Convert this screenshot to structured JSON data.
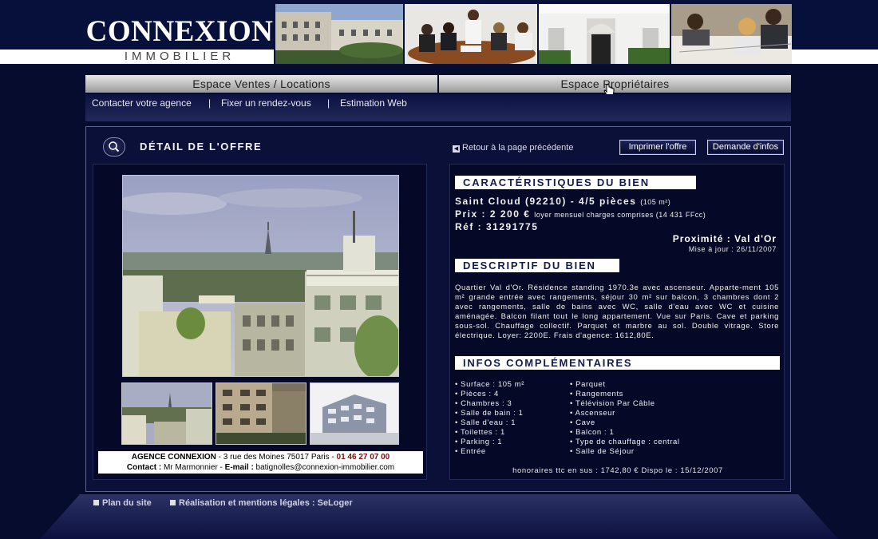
{
  "header": {
    "logo_main": "CONNEXION",
    "logo_sub": "IMMOBILIER"
  },
  "nav": {
    "tab_ventes": "Espace Ventes / Locations",
    "tab_proprietaires": "Espace Propriétaires",
    "sub_contact": "Contacter votre agence",
    "sub_rdv": "Fixer un rendez-vous",
    "sub_estimation": "Estimation Web",
    "sep": "|"
  },
  "offer": {
    "title": "DÉTAIL DE L'OFFRE",
    "back_link": "Retour à la page précédente",
    "print_button": "Imprimer l'offre",
    "info_button": "Demande d'infos"
  },
  "agency": {
    "name": "AGENCE CONNEXION",
    "address": " - 3 rue des Moines 75017 Paris - ",
    "phone": "01 46 27 07 00",
    "contact_label": "Contact :",
    "contact_name": " Mr Marmonnier - ",
    "email_label": "E-mail :",
    "email": " batignolles@connexion-immobilier.com"
  },
  "caracteristiques": {
    "title": "CARACTÉRISTIQUES DU BIEN",
    "location": "Saint Cloud (92210) - 4/5 pièces",
    "surface_note": "(105 m²)",
    "price": "Prix : 2 200 €",
    "price_note": "loyer mensuel charges comprises (14 431 FFcc)",
    "ref": "Réf : 31291775",
    "proximite": "Proximité : Val d'Or",
    "mise_a_jour": "Mise à jour : 26/11/2007"
  },
  "descriptif": {
    "title": "DESCRIPTIF DU BIEN",
    "text": "Quartier Val d'Or. Résidence standing 1970.3e avec ascenseur. Apparte-ment 105 m² grande entrée avec rangements, séjour 30 m² sur balcon, 3 chambres dont 2 avec rangements, salle de bains avec WC, salle d'eau avec WC et cuisine aménagée. Balcon filant tout le long appartement. Vue sur Paris. Cave et parking sous-sol. Chauffage collectif. Parquet et marbre au sol. Double vitrage. Store électrique. Loyer: 2200E. Frais d'agence: 1612,80E."
  },
  "infos": {
    "title": "INFOS COMPLÉMENTAIRES",
    "left": [
      "• Surface : 105 m²",
      "• Pièces : 4",
      "• Chambres : 3",
      "• Salle de bain : 1",
      "• Salle d'eau : 1",
      "• Toilettes : 1",
      "• Parking : 1",
      "• Entrée"
    ],
    "right": [
      "• Parquet",
      "• Rangements",
      "• Télévision Par Câble",
      "• Ascenseur",
      "• Cave",
      "• Balcon : 1",
      "• Type de chauffage : central",
      "• Salle de Séjour"
    ],
    "honoraires": "honoraires ttc en sus : 1742,80 €  Dispo le : 15/12/2007"
  },
  "footer": {
    "plan": "Plan du site",
    "mentions": "Réalisation et mentions légales : SeLoger"
  },
  "icons": {
    "title_icon": "magnifier-icon",
    "back_icon": "arrow-left-icon",
    "cursor": "hand-cursor-icon"
  },
  "colors": {
    "background": "#060c2e",
    "panel": "#050827",
    "accent_white": "#ffffff"
  }
}
